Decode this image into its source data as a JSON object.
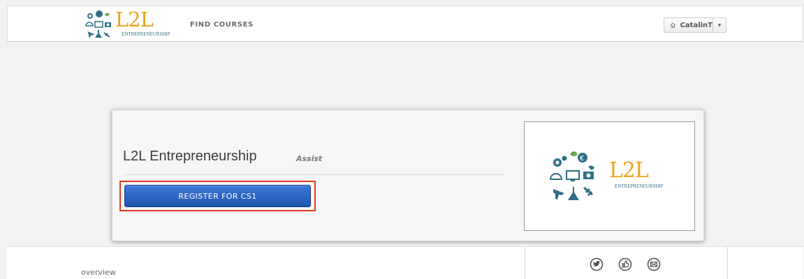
{
  "header": {
    "logo_text": "L2L",
    "logo_subtext": "ENTREPRENEURSHIP",
    "nav": {
      "find_courses": "FIND COURSES"
    },
    "user": {
      "name": "CatalinT",
      "home_icon": "home-icon",
      "menu_icon": "caret-down-icon"
    }
  },
  "course": {
    "title": "L2L Entrepreneurship",
    "org": "Assist",
    "register_label": "REGISTER FOR CS1",
    "image": {
      "logo_text": "L2L",
      "logo_subtext": "ENTREPRENEURSHIP"
    }
  },
  "lower": {
    "overview_label": "overview",
    "share_icons": [
      "twitter-icon",
      "facebook-like-icon",
      "email-icon"
    ]
  },
  "colors": {
    "logo_orange": "#f0a21c",
    "logo_teal": "#2f6f86",
    "register_blue": "#2a64c4",
    "highlight_red": "#e0391a"
  }
}
